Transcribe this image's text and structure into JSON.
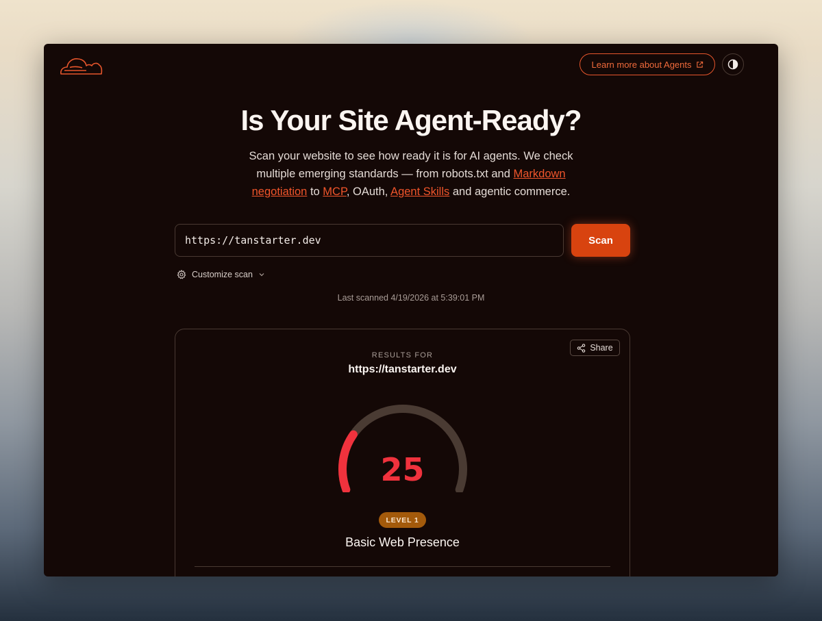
{
  "header": {
    "learn_more_label": "Learn more about Agents",
    "theme_toggle_icon": "contrast-icon",
    "brand_color": "#f06a3b"
  },
  "hero": {
    "title": "Is Your Site Agent-Ready?",
    "desc_1": "Scan your website to see how ready it is for AI agents. We check multiple emerging standards — from robots.txt and ",
    "link_markdown": "Markdown negotiation",
    "desc_2": " to ",
    "link_mcp": "MCP",
    "desc_3": ", OAuth, ",
    "link_skills": "Agent Skills",
    "desc_4": " and agentic commerce."
  },
  "scan": {
    "url_value": "https://tanstarter.dev",
    "button_label": "Scan",
    "customize_label": "Customize scan",
    "last_scanned": "Last scanned 4/19/2026 at 5:39:01 PM"
  },
  "results": {
    "share_label": "Share",
    "results_for_label": "RESULTS FOR",
    "url": "https://tanstarter.dev",
    "score": "25",
    "score_max": 100,
    "level_badge": "LEVEL 1",
    "level_name": "Basic Web Presence",
    "score_color": "#f0323d",
    "track_color": "#4a3b33"
  }
}
